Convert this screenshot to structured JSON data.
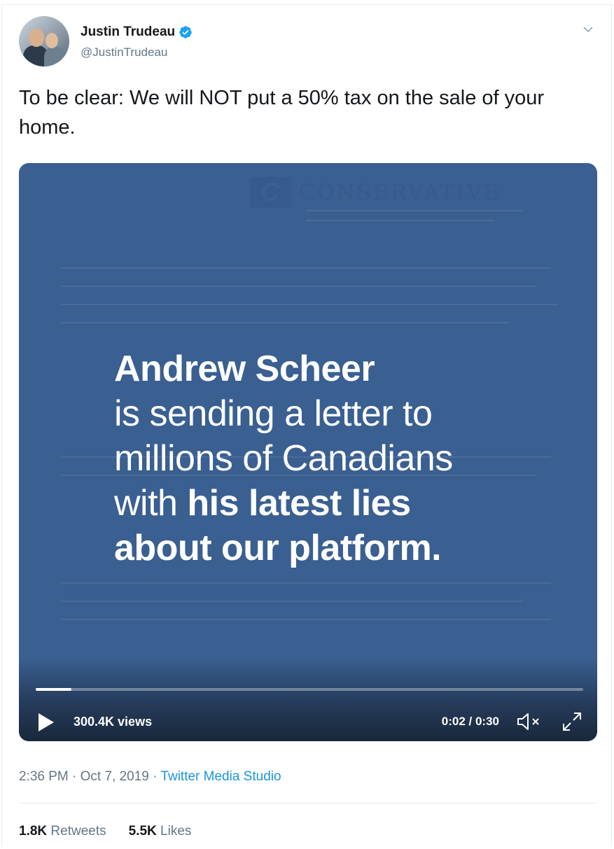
{
  "author": {
    "name": "Justin Trudeau",
    "handle": "@JustinTrudeau",
    "verified": true
  },
  "tweet": {
    "text": "To be clear: We will NOT put a 50% tax on the sale of your home."
  },
  "video": {
    "watermark": "CONSERVATIVE",
    "overlay": {
      "line1": "Andrew Scheer",
      "line2": "is sending a letter to",
      "line3": "millions of Canadians",
      "line4_light": "with ",
      "line4_bold": "his latest lies",
      "line5": "about our platform."
    },
    "views": "300.4K views",
    "time": "0:02 / 0:30",
    "progress": 0.065,
    "background_color": "#3a5f91"
  },
  "meta": {
    "time": "2:36 PM · Oct 7, 2019",
    "separator": "·",
    "source": "Twitter Media Studio"
  },
  "stats": {
    "retweets_count": "1.8K",
    "retweets_label": "Retweets",
    "likes_count": "5.5K",
    "likes_label": "Likes"
  },
  "colors": {
    "link": "#1b95e0",
    "secondary": "#657786",
    "verified": "#1da1f2"
  }
}
